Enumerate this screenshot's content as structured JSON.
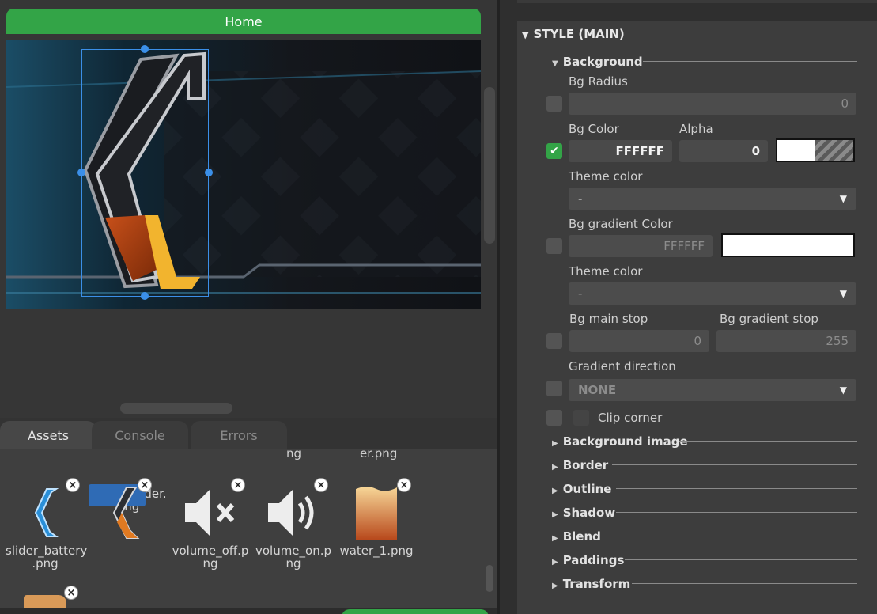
{
  "canvas": {
    "screen_title": "Home"
  },
  "bottom_tabs": [
    "Assets",
    "Console",
    "Errors"
  ],
  "assets": {
    "cut_labels": [
      "ng",
      "er.png"
    ],
    "items": [
      {
        "name": "slider_battery\n.png",
        "icon": "slider-battery-thumbnail"
      },
      {
        "name": "speed_slider.\npng",
        "icon": "speed-slider-thumbnail",
        "selected": true
      },
      {
        "name": "volume_off.p\nng",
        "icon": "volume-off-thumbnail"
      },
      {
        "name": "volume_on.p\nng",
        "icon": "volume-on-thumbnail"
      },
      {
        "name": "water_1.png",
        "icon": "water-thumbnail"
      }
    ],
    "close_glyph": "×"
  },
  "style": {
    "section_title": "STYLE (MAIN)",
    "background": {
      "title": "Background",
      "bg_radius_label": "Bg Radius",
      "bg_radius_value": "0",
      "bg_color_label": "Bg Color",
      "bg_color_value": "FFFFFF",
      "bg_color_checked": true,
      "alpha_label": "Alpha",
      "alpha_value": "0",
      "theme_color_label": "Theme color",
      "theme_color_value": "-",
      "gradient_color_label": "Bg gradient Color",
      "gradient_color_value": "FFFFFF",
      "theme_color2_label": "Theme color",
      "theme_color2_value": "-",
      "main_stop_label": "Bg main stop",
      "main_stop_value": "0",
      "gradient_stop_label": "Bg gradient stop",
      "gradient_stop_value": "255",
      "gradient_direction_label": "Gradient direction",
      "gradient_direction_value": "NONE",
      "clip_corner_label": "Clip corner"
    },
    "groups": [
      "Background image",
      "Border",
      "Outline",
      "Shadow",
      "Blend",
      "Paddings",
      "Transform"
    ]
  },
  "colors": {
    "accent_green": "#33a447",
    "selection_blue": "#3b8fe8"
  }
}
